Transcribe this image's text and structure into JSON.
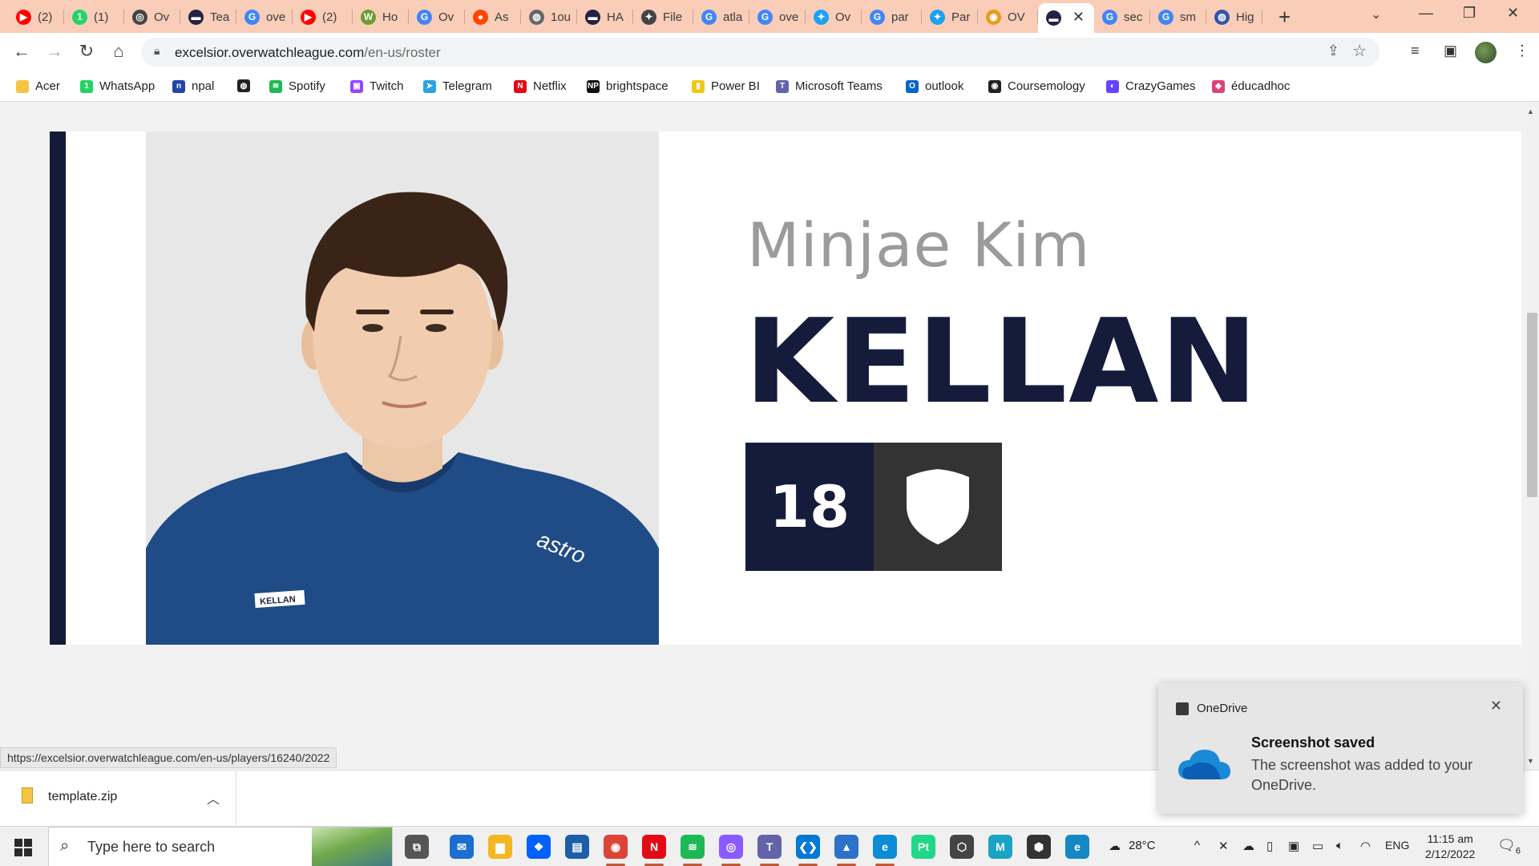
{
  "browser": {
    "tabs": [
      {
        "label": "(2)",
        "icon": "youtube-icon",
        "color": "#ff0000",
        "glyph": "▶"
      },
      {
        "label": "(1)",
        "icon": "whatsapp-icon",
        "color": "#25d366",
        "glyph": "1"
      },
      {
        "label": "Ov",
        "icon": "overwatch-icon",
        "color": "#444444",
        "glyph": "◎"
      },
      {
        "label": "Tea",
        "icon": "excelsior-icon",
        "color": "#222244",
        "glyph": "▬"
      },
      {
        "label": "ove",
        "icon": "google-icon",
        "color": "#4285f4",
        "glyph": "G"
      },
      {
        "label": "(2)",
        "icon": "youtube-icon",
        "color": "#ff0000",
        "glyph": "▶"
      },
      {
        "label": "Ho",
        "icon": "wikihow-icon",
        "color": "#6a9c2f",
        "glyph": "W"
      },
      {
        "label": "Ov",
        "icon": "google-icon",
        "color": "#4285f4",
        "glyph": "G"
      },
      {
        "label": "As",
        "icon": "reddit-icon",
        "color": "#ff4500",
        "glyph": "●"
      },
      {
        "label": "1ou",
        "icon": "globe-icon",
        "color": "#666666",
        "glyph": "◍"
      },
      {
        "label": "HA",
        "icon": "excelsior-icon",
        "color": "#222244",
        "glyph": "▬"
      },
      {
        "label": "File",
        "icon": "file-icon",
        "color": "#444444",
        "glyph": "✦"
      },
      {
        "label": "atla",
        "icon": "google-icon",
        "color": "#4285f4",
        "glyph": "G"
      },
      {
        "label": "ove",
        "icon": "google-icon",
        "color": "#4285f4",
        "glyph": "G"
      },
      {
        "label": "Ov",
        "icon": "twitter-icon",
        "color": "#1da1f2",
        "glyph": "✦"
      },
      {
        "label": "par",
        "icon": "google-icon",
        "color": "#4285f4",
        "glyph": "G"
      },
      {
        "label": "Par",
        "icon": "twitter-icon",
        "color": "#1da1f2",
        "glyph": "✦"
      },
      {
        "label": "OV",
        "icon": "owl-icon",
        "color": "#e89a1a",
        "glyph": "◉"
      },
      {
        "label": "",
        "icon": "excelsior-icon",
        "color": "#222244",
        "glyph": "▬",
        "active": true
      },
      {
        "label": "sec",
        "icon": "google-icon",
        "color": "#4285f4",
        "glyph": "G"
      },
      {
        "label": "sm",
        "icon": "google-icon",
        "color": "#4285f4",
        "glyph": "G"
      },
      {
        "label": "Hig",
        "icon": "globe-icon",
        "color": "#3355aa",
        "glyph": "◍"
      }
    ],
    "url_host": "excelsior.overwatchleague.com",
    "url_path": "/en-us/roster",
    "bookmarks": [
      {
        "label": "Acer",
        "icon": "folder-icon",
        "color": "#f4c542",
        "glyph": ""
      },
      {
        "label": "WhatsApp",
        "icon": "whatsapp-icon",
        "color": "#25d366",
        "glyph": "1"
      },
      {
        "label": "npal",
        "icon": "npal-icon",
        "color": "#2244aa",
        "glyph": "n"
      },
      {
        "label": "",
        "icon": "globe-icon",
        "color": "#222222",
        "glyph": "◍"
      },
      {
        "label": "Spotify",
        "icon": "spotify-icon",
        "color": "#1db954",
        "glyph": "≋"
      },
      {
        "label": "Twitch",
        "icon": "twitch-icon",
        "color": "#9146ff",
        "glyph": "▣"
      },
      {
        "label": "Telegram",
        "icon": "telegram-icon",
        "color": "#2aa3e0",
        "glyph": "➤"
      },
      {
        "label": "Netflix",
        "icon": "netflix-icon",
        "color": "#e50914",
        "glyph": "N"
      },
      {
        "label": "brightspace",
        "icon": "np-icon",
        "color": "#111111",
        "glyph": "NP"
      },
      {
        "label": "Power BI",
        "icon": "powerbi-icon",
        "color": "#f2c811",
        "glyph": "▮"
      },
      {
        "label": "Microsoft Teams",
        "icon": "teams-icon",
        "color": "#6264a7",
        "glyph": "T"
      },
      {
        "label": "outlook",
        "icon": "outlook-icon",
        "color": "#0a64c8",
        "glyph": "O"
      },
      {
        "label": "Coursemology",
        "icon": "coursemology-icon",
        "color": "#222222",
        "glyph": "◉"
      },
      {
        "label": "CrazyGames",
        "icon": "crazygames-icon",
        "color": "#6842ff",
        "glyph": "◐"
      },
      {
        "label": "éducadhoc",
        "icon": "educadhoc-icon",
        "color": "#e0407a",
        "glyph": "◆"
      }
    ]
  },
  "player": {
    "given_name": "Minjae Kim",
    "handle": "KELLAN",
    "number": "18",
    "role_icon": "shield-icon",
    "jersey_tag": "KELLAN",
    "sponsor": "astro"
  },
  "status_url": "https://excelsior.overwatchleague.com/en-us/players/16240/2022",
  "downloads": {
    "file": "template.zip"
  },
  "toast": {
    "app": "OneDrive",
    "title": "Screenshot saved",
    "message": "The screenshot was added to your OneDrive."
  },
  "taskbar": {
    "search_placeholder": "Type here to search",
    "apps": [
      {
        "name": "task-view-icon",
        "color": "#555555",
        "glyph": "⧉"
      },
      {
        "name": "mail-icon",
        "color": "#1a6fd1",
        "glyph": "✉"
      },
      {
        "name": "file-explorer-icon",
        "color": "#f2b824",
        "glyph": "▆"
      },
      {
        "name": "dropbox-icon",
        "color": "#0061ff",
        "glyph": "❖"
      },
      {
        "name": "app-blue-icon",
        "color": "#1c5fa8",
        "glyph": "▤"
      },
      {
        "name": "chrome-icon",
        "color": "#db4437",
        "glyph": "◉"
      },
      {
        "name": "netflix-icon",
        "color": "#e50914",
        "glyph": "N"
      },
      {
        "name": "spotify-icon",
        "color": "#1db954",
        "glyph": "≋"
      },
      {
        "name": "messenger-icon",
        "color": "#8a5cff",
        "glyph": "◎"
      },
      {
        "name": "teams-icon",
        "color": "#6264a7",
        "glyph": "T"
      },
      {
        "name": "vscode-icon",
        "color": "#0078d4",
        "glyph": "❮❯"
      },
      {
        "name": "photos-icon",
        "color": "#2b72c8",
        "glyph": "▲"
      },
      {
        "name": "edge-icon",
        "color": "#0c8bd6",
        "glyph": "e"
      },
      {
        "name": "pycharm-icon",
        "color": "#21d789",
        "glyph": "Pt"
      },
      {
        "name": "unity-icon",
        "color": "#444444",
        "glyph": "⬡"
      },
      {
        "name": "maya-icon",
        "color": "#1aa3c4",
        "glyph": "M"
      },
      {
        "name": "unity-hub-icon",
        "color": "#333333",
        "glyph": "⬢"
      },
      {
        "name": "edge-dev-icon",
        "color": "#1488c4",
        "glyph": "e"
      }
    ],
    "weather": "28°C",
    "language": "ENG",
    "time": "11:15 am",
    "date": "2/12/2022",
    "notifications": "6"
  }
}
